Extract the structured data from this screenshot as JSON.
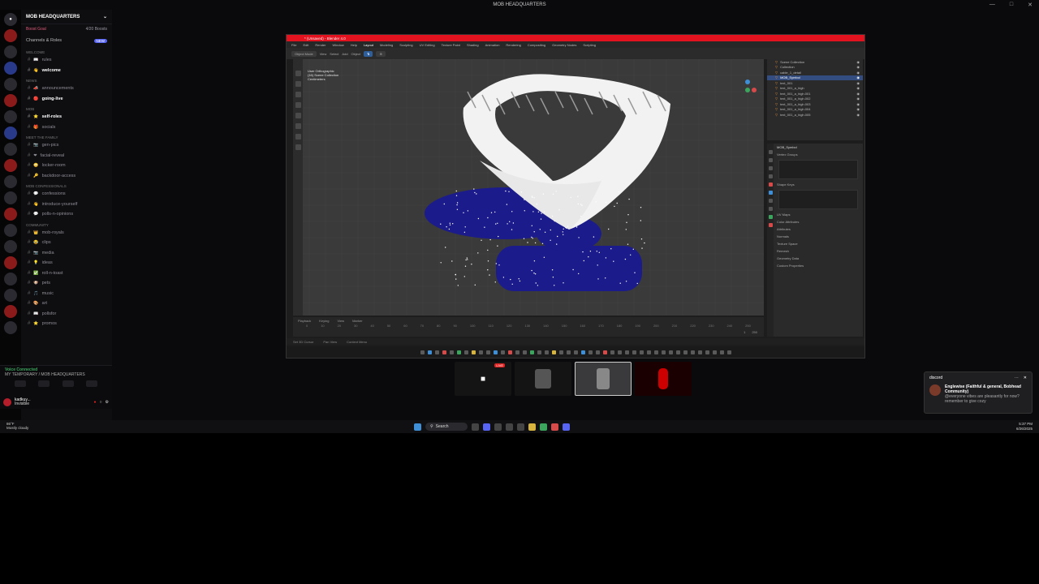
{
  "window_title": "MOB HEADQUARTERS",
  "server": {
    "name": "MOB HEADQUARTERS",
    "boost_goal": "Boost Goal",
    "boosts": "4/20 Boosts",
    "channels_roles": "Channels & Roles",
    "new_badge": "NEW"
  },
  "categories": [
    {
      "name": "WELCOME",
      "channels": [
        {
          "icon": "book",
          "label": "rules",
          "bright": false
        },
        {
          "icon": "wave",
          "label": "welcome",
          "bright": true
        }
      ]
    },
    {
      "name": "NEWS",
      "channels": [
        {
          "icon": "megaphone",
          "label": "announcements",
          "bright": false
        },
        {
          "icon": "live",
          "label": "going-live",
          "bright": true
        }
      ]
    },
    {
      "name": "MOB",
      "channels": [
        {
          "icon": "star",
          "label": "self-roles",
          "bright": true
        },
        {
          "icon": "gift",
          "label": "socials",
          "bright": false
        }
      ]
    },
    {
      "name": "Meet the family",
      "channels": [
        {
          "icon": "camera",
          "label": "gen-pics",
          "bright": false
        },
        {
          "icon": "heart",
          "label": "facial-reveal",
          "bright": false
        },
        {
          "icon": "blush",
          "label": "locker-room",
          "bright": false
        },
        {
          "icon": "key",
          "label": "backdoor-access",
          "bright": false
        }
      ]
    },
    {
      "name": "Mob Confessionals",
      "channels": [
        {
          "icon": "speech",
          "label": "confessions",
          "bright": false
        },
        {
          "icon": "wave",
          "label": "introduce-yourself",
          "bright": false
        },
        {
          "icon": "speech",
          "label": "polls-n-opinions",
          "bright": false
        }
      ]
    },
    {
      "name": "COMMUNITY",
      "channels": [
        {
          "icon": "crown",
          "label": "mob-royals",
          "bright": false
        },
        {
          "icon": "laugh",
          "label": "clips",
          "bright": false
        },
        {
          "icon": "camera",
          "label": "media",
          "bright": false
        },
        {
          "icon": "bulb",
          "label": "ideas",
          "bright": false
        },
        {
          "icon": "check",
          "label": "roll-n-toast",
          "bright": false
        },
        {
          "icon": "pet",
          "label": "pets",
          "bright": false
        },
        {
          "icon": "music",
          "label": "music",
          "bright": false
        },
        {
          "icon": "art",
          "label": "art",
          "bright": false
        },
        {
          "icon": "book",
          "label": "pollsfor",
          "bright": false
        },
        {
          "icon": "star",
          "label": "promos",
          "bright": false
        }
      ]
    }
  ],
  "voice": {
    "status": "Voice Connected",
    "channel": "MY TEMPORARY / MOB HEADQUARTERS"
  },
  "user": {
    "name": "kadkuy...",
    "status": "Invisible"
  },
  "weather": {
    "temp": "86°F",
    "desc": "Mostly cloudy"
  },
  "blender": {
    "title": "* (Unsaved) - Blender 4.0",
    "menus": [
      "File",
      "Edit",
      "Render",
      "Window",
      "Help",
      "Layout",
      "Modeling",
      "Sculpting",
      "UV Editing",
      "Texture Paint",
      "Shading",
      "Animation",
      "Rendering",
      "Compositing",
      "Geometry Nodes",
      "Scripting"
    ],
    "active_menu": "Layout",
    "mode": "Object Mode",
    "toolbar": [
      "View",
      "Select",
      "Add",
      "Object"
    ],
    "viewport_info": [
      "User Orthographic",
      "(16) Scene Collection",
      "Centimeters"
    ],
    "outliner": [
      {
        "label": "Scene Collection",
        "selected": false
      },
      {
        "label": "Collection",
        "selected": false
      },
      {
        "label": "cable_1_detail",
        "selected": false
      },
      {
        "label": "MOB_Symbol",
        "selected": true
      },
      {
        "label": "text_001",
        "selected": false
      },
      {
        "label": "text_001_a_high",
        "selected": false
      },
      {
        "label": "text_001_a_high.001",
        "selected": false
      },
      {
        "label": "text_001_a_high.002",
        "selected": false
      },
      {
        "label": "text_001_a_high.003",
        "selected": false
      },
      {
        "label": "text_001_a_high.004",
        "selected": false
      },
      {
        "label": "text_001_a_high.005",
        "selected": false
      }
    ],
    "props_object": "MOB_Symbol",
    "props_sections": [
      "Vertex Groups",
      "Shape Keys",
      "UV Maps",
      "Color Attributes",
      "Attributes",
      "Normals",
      "Texture Space",
      "Remesh",
      "Geometry Data",
      "Custom Properties"
    ],
    "timeline": [
      "Playback",
      "Keying",
      "View",
      "Marker"
    ],
    "ruler": [
      "0",
      "10",
      "20",
      "30",
      "40",
      "50",
      "60",
      "70",
      "80",
      "90",
      "100",
      "110",
      "120",
      "130",
      "140",
      "150",
      "160",
      "170",
      "180",
      "190",
      "200",
      "210",
      "220",
      "230",
      "240",
      "250"
    ],
    "frame_start": "1",
    "frame_end": "250",
    "status": [
      "Set 3D Cursor",
      "Pan View",
      "Context Menu"
    ]
  },
  "stream": {
    "live_badge": "LIVE"
  },
  "notification": {
    "app": "discord",
    "title": "Englewise (Faithful & general, Bobhead Community)",
    "text": "@everyone vibes are pleasantly for now? remember to give cozy"
  },
  "taskbar": {
    "search": "Search",
    "time": "5:37 PM",
    "date": "6/26/2025"
  },
  "colors": {
    "blender_title": "#e2121f",
    "mesh_blue": "#1b1b8c",
    "accent": "#5865f2",
    "voice_green": "#3ba55d"
  }
}
